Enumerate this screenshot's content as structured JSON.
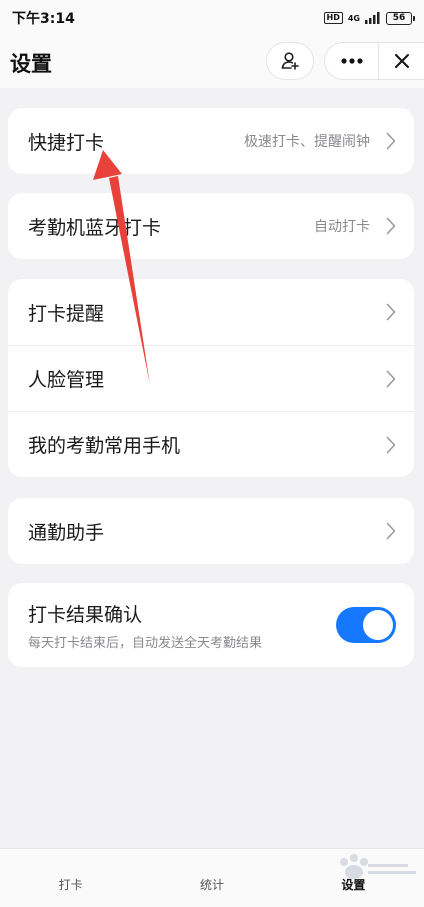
{
  "status_bar": {
    "time": "下午3:14",
    "hd": "HD",
    "network": "4G",
    "battery": "56"
  },
  "nav": {
    "title": "设置"
  },
  "groups": {
    "quick": {
      "label": "快捷打卡",
      "value": "极速打卡、提醒闹钟"
    },
    "bluetooth": {
      "label": "考勤机蓝牙打卡",
      "value": "自动打卡"
    },
    "misc": [
      {
        "label": "打卡提醒"
      },
      {
        "label": "人脸管理"
      },
      {
        "label": "我的考勤常用手机"
      }
    ],
    "commute": {
      "label": "通勤助手"
    },
    "confirm": {
      "label": "打卡结果确认",
      "sub": "每天打卡结束后，自动发送全天考勤结果",
      "enabled": true
    }
  },
  "tabs": [
    {
      "label": "打卡"
    },
    {
      "label": "统计"
    },
    {
      "label": "设置",
      "active": true
    }
  ],
  "colors": {
    "accent": "#1677ff",
    "annotation_arrow": "#e8413a"
  }
}
